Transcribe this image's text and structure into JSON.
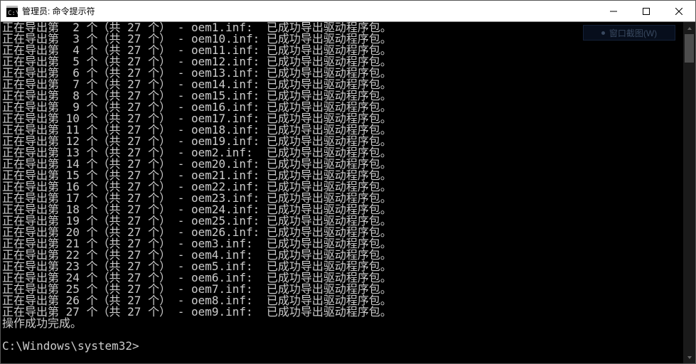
{
  "window": {
    "title": "管理员: 命令提示符"
  },
  "ghost_button": {
    "label": "窗口截图(W)"
  },
  "console": {
    "export_prefix": "正在导出第 ",
    "total_mid": " 个（共 ",
    "total_count": "27",
    "total_suffix": " 个） - ",
    "success_msg": "已成功导出驱动程序包。",
    "done_msg": "操作成功完成。",
    "prompt_path": "C:\\Windows\\system32>",
    "rows": [
      {
        "idx": "2",
        "file": "oem1.inf:"
      },
      {
        "idx": "3",
        "file": "oem10.inf:"
      },
      {
        "idx": "4",
        "file": "oem11.inf:"
      },
      {
        "idx": "5",
        "file": "oem12.inf:"
      },
      {
        "idx": "6",
        "file": "oem13.inf:"
      },
      {
        "idx": "7",
        "file": "oem14.inf:"
      },
      {
        "idx": "8",
        "file": "oem15.inf:"
      },
      {
        "idx": "9",
        "file": "oem16.inf:"
      },
      {
        "idx": "10",
        "file": "oem17.inf:"
      },
      {
        "idx": "11",
        "file": "oem18.inf:"
      },
      {
        "idx": "12",
        "file": "oem19.inf:"
      },
      {
        "idx": "13",
        "file": "oem2.inf:"
      },
      {
        "idx": "14",
        "file": "oem20.inf:"
      },
      {
        "idx": "15",
        "file": "oem21.inf:"
      },
      {
        "idx": "16",
        "file": "oem22.inf:"
      },
      {
        "idx": "17",
        "file": "oem23.inf:"
      },
      {
        "idx": "18",
        "file": "oem24.inf:"
      },
      {
        "idx": "19",
        "file": "oem25.inf:"
      },
      {
        "idx": "20",
        "file": "oem26.inf:"
      },
      {
        "idx": "21",
        "file": "oem3.inf:"
      },
      {
        "idx": "22",
        "file": "oem4.inf:"
      },
      {
        "idx": "23",
        "file": "oem5.inf:"
      },
      {
        "idx": "24",
        "file": "oem6.inf:"
      },
      {
        "idx": "25",
        "file": "oem7.inf:"
      },
      {
        "idx": "26",
        "file": "oem8.inf:"
      },
      {
        "idx": "27",
        "file": "oem9.inf:"
      }
    ]
  }
}
